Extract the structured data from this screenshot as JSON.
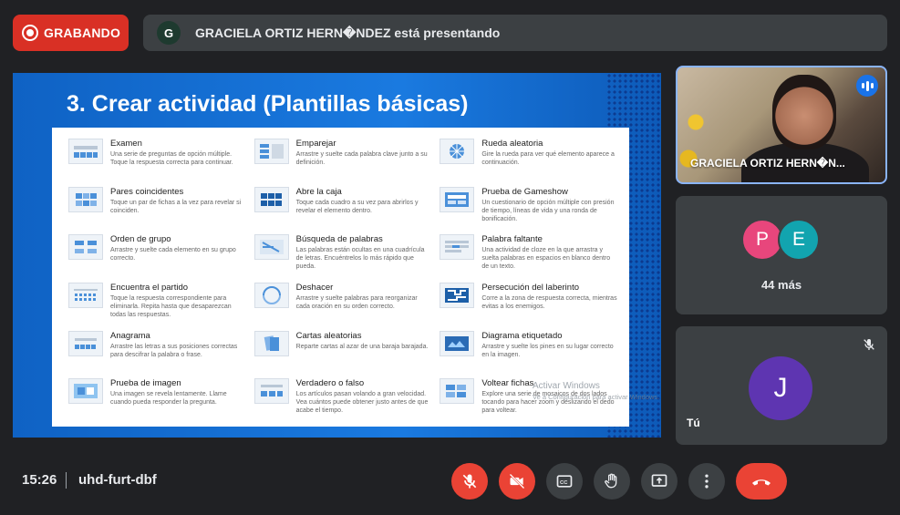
{
  "recording": {
    "label": "GRABANDO"
  },
  "presenting": {
    "avatar_initial": "G",
    "text": "GRACIELA ORTIZ HERN�NDEZ está presentando"
  },
  "slide": {
    "title": "3. Crear actividad  (Plantillas básicas)",
    "templates": [
      {
        "name": "Examen",
        "desc": "Una serie de preguntas de opción múltiple. Toque la respuesta correcta para continuar."
      },
      {
        "name": "Emparejar",
        "desc": "Arrastre y suelte cada palabra clave junto a su definición."
      },
      {
        "name": "Rueda aleatoria",
        "desc": "Gire la rueda para ver qué elemento aparece a continuación."
      },
      {
        "name": "Pares coincidentes",
        "desc": "Toque un par de fichas a la vez para revelar si coinciden."
      },
      {
        "name": "Abre la caja",
        "desc": "Toque cada cuadro a su vez para abrirlos y revelar el elemento dentro."
      },
      {
        "name": "Prueba de Gameshow",
        "desc": "Un cuestionario de opción múltiple con presión de tiempo, líneas de vida y una ronda de bonificación."
      },
      {
        "name": "Orden de grupo",
        "desc": "Arrastre y suelte cada elemento en su grupo correcto."
      },
      {
        "name": "Búsqueda de palabras",
        "desc": "Las palabras están ocultas en una cuadrícula de letras. Encuéntrelos lo más rápido que pueda."
      },
      {
        "name": "Palabra faltante",
        "desc": "Una actividad de cloze en la que arrastra y suelta palabras en espacios en blanco dentro de un texto."
      },
      {
        "name": "Encuentra el partido",
        "desc": "Toque la respuesta correspondiente para eliminarla. Repita hasta que desaparezcan todas las respuestas."
      },
      {
        "name": "Deshacer",
        "desc": "Arrastre y suelte palabras para reorganizar cada oración en su orden correcto."
      },
      {
        "name": "Persecución del laberinto",
        "desc": "Corre a la zona de respuesta correcta, mientras evitas a los enemigos."
      },
      {
        "name": "Anagrama",
        "desc": "Arrastre las letras a sus posiciones correctas para descifrar la palabra o frase."
      },
      {
        "name": "Cartas aleatorias",
        "desc": "Reparte cartas al azar de una baraja barajada."
      },
      {
        "name": "Diagrama etiquetado",
        "desc": "Arrastre y suelte los pines en su lugar correcto en la imagen."
      },
      {
        "name": "Prueba de imagen",
        "desc": "Una imagen se revela lentamente. Llame cuando pueda responder la pregunta."
      },
      {
        "name": "Verdadero o falso",
        "desc": "Los artículos pasan volando a gran velocidad. Vea cuántos puede obtener justo antes de que acabe el tiempo."
      },
      {
        "name": "Voltear fichas",
        "desc": "Explore una serie de mosaicos de dos lados tocando para hacer zoom y deslizando el dedo para voltear."
      }
    ],
    "watermark": {
      "line1": "Activar Windows",
      "line2": "Ve a Configuración para activar Windows."
    }
  },
  "participants": {
    "main": {
      "name": "GRACIELA ORTIZ HERN�N..."
    },
    "more": {
      "avatars": [
        {
          "initial": "P",
          "color": "#e8467c"
        },
        {
          "initial": "E",
          "color": "#12a4af"
        }
      ],
      "count_label": "44 más"
    },
    "self": {
      "initial": "J",
      "name": "Tú"
    }
  },
  "footer": {
    "time": "15:26",
    "meeting_code": "uhd-furt-dbf"
  }
}
